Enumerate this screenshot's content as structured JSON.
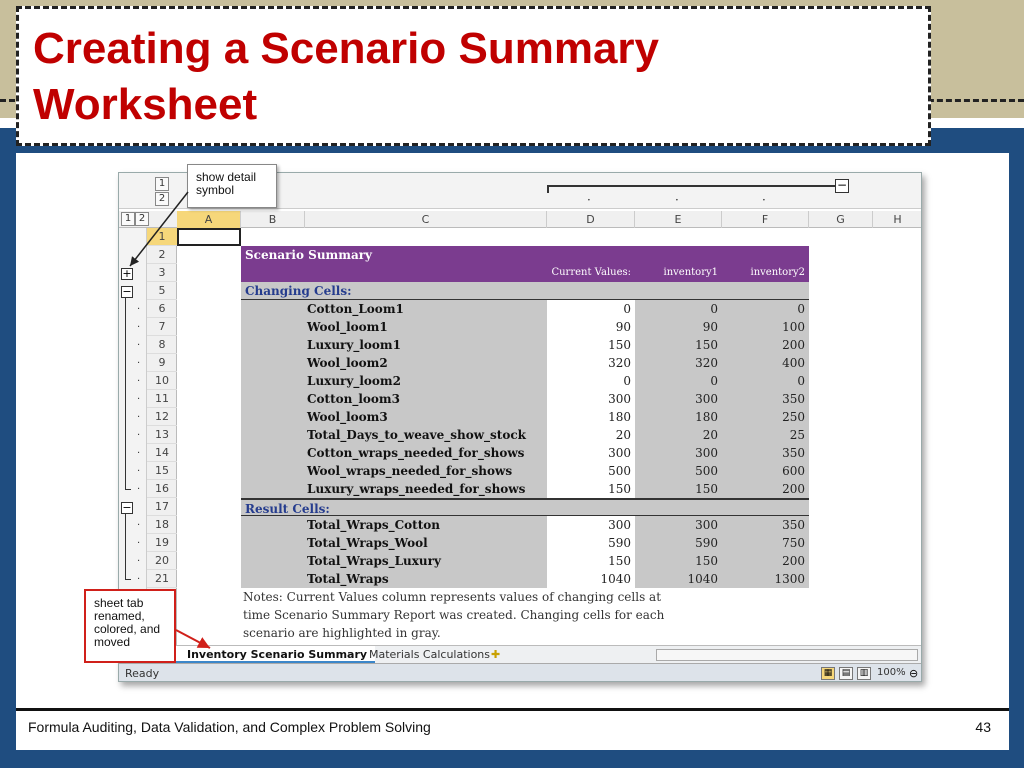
{
  "slide": {
    "title_line1": "Creating a Scenario Summary",
    "title_line2": "Worksheet",
    "footer_text": "Formula Auditing, Data Validation, and Complex Problem Solving",
    "page_number": "43",
    "colors": {
      "title": "#c00000",
      "background": "#1f4d80",
      "band": "#c8bf9c"
    }
  },
  "callouts": {
    "detail": "show detail symbol",
    "tab": "sheet tab renamed, colored, and moved"
  },
  "excel": {
    "outline_levels": [
      "1",
      "2"
    ],
    "column_headers": [
      "A",
      "B",
      "C",
      "D",
      "E",
      "F",
      "G",
      "H"
    ],
    "row_headers": [
      "1",
      "2",
      "3",
      "5",
      "6",
      "7",
      "8",
      "9",
      "10",
      "11",
      "12",
      "13",
      "14",
      "15",
      "16",
      "17",
      "18",
      "19",
      "20",
      "21"
    ],
    "summary": {
      "title": "Scenario Summary",
      "col_current": "Current Values:",
      "col_s1": "inventory1",
      "col_s2": "inventory2",
      "changing_label": "Changing Cells:",
      "changing": [
        {
          "name": "Cotton_Loom1",
          "cur": "0",
          "s1": "0",
          "s2": "0"
        },
        {
          "name": "Wool_loom1",
          "cur": "90",
          "s1": "90",
          "s2": "100"
        },
        {
          "name": "Luxury_loom1",
          "cur": "150",
          "s1": "150",
          "s2": "200"
        },
        {
          "name": "Wool_loom2",
          "cur": "320",
          "s1": "320",
          "s2": "400"
        },
        {
          "name": "Luxury_loom2",
          "cur": "0",
          "s1": "0",
          "s2": "0"
        },
        {
          "name": "Cotton_loom3",
          "cur": "300",
          "s1": "300",
          "s2": "350"
        },
        {
          "name": "Wool_loom3",
          "cur": "180",
          "s1": "180",
          "s2": "250"
        },
        {
          "name": "Total_Days_to_weave_show_stock",
          "cur": "20",
          "s1": "20",
          "s2": "25"
        },
        {
          "name": "Cotton_wraps_needed_for_shows",
          "cur": "300",
          "s1": "300",
          "s2": "350"
        },
        {
          "name": "Wool_wraps_needed_for_shows",
          "cur": "500",
          "s1": "500",
          "s2": "600"
        },
        {
          "name": "Luxury_wraps_needed_for_shows",
          "cur": "150",
          "s1": "150",
          "s2": "200"
        }
      ],
      "result_label": "Result Cells:",
      "results": [
        {
          "name": "Total_Wraps_Cotton",
          "cur": "300",
          "s1": "300",
          "s2": "350"
        },
        {
          "name": "Total_Wraps_Wool",
          "cur": "590",
          "s1": "590",
          "s2": "750"
        },
        {
          "name": "Total_Wraps_Luxury",
          "cur": "150",
          "s1": "150",
          "s2": "200"
        },
        {
          "name": "Total_Wraps",
          "cur": "1040",
          "s1": "1040",
          "s2": "1300"
        }
      ],
      "notes_line1": "Notes:  Current Values column represents values of changing cells at",
      "notes_line2": "time Scenario Summary Report was created.  Changing cells for each",
      "notes_line3": "scenario are highlighted in gray.",
      "colors": {
        "header": "#7b3c8f",
        "gray": "#c8c8c8",
        "section_text": "#253c8e"
      }
    },
    "tabs": {
      "active": "Inventory Scenario Summary",
      "other": "Materials Calculations"
    },
    "status": {
      "ready": "Ready",
      "zoom": "100%"
    }
  }
}
